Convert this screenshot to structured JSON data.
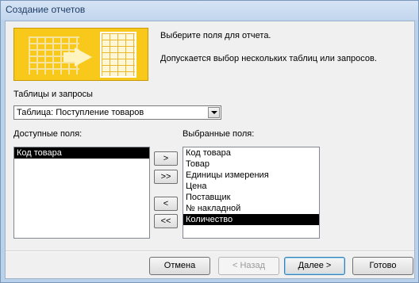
{
  "window": {
    "title": "Создание отчетов"
  },
  "intro": {
    "line1": "Выберите поля для отчета.",
    "line2": "Допускается выбор нескольких таблиц или запросов."
  },
  "source": {
    "label": "Таблицы и запросы",
    "selected": "Таблица: Поступление товаров"
  },
  "available": {
    "label": "Доступные поля:",
    "items": [
      "Код товара"
    ],
    "selected_index": 0
  },
  "chosen": {
    "label": "Выбранные поля:",
    "items": [
      "Код товара",
      "Товар",
      "Единицы измерения",
      "Цена",
      "Поставщик",
      "№ накладной",
      "Количество"
    ],
    "selected_index": 6
  },
  "move_buttons": {
    "add": ">",
    "add_all": ">>",
    "remove": "<",
    "remove_all": "<<"
  },
  "footer": {
    "cancel": "Отмена",
    "back": "< Назад",
    "next": "Далее >",
    "finish": "Готово"
  },
  "colors": {
    "banner": "#f8c81a",
    "selection": "#000000",
    "dialog_bg": "#f0f0f0"
  }
}
